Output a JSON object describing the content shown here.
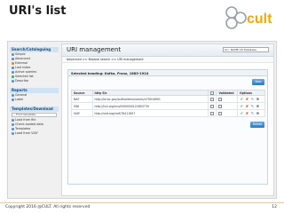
{
  "slide": {
    "title": "URI's list",
    "copyright": "Copyright 2016 @CULT. All rights reserved",
    "page_number": "12",
    "logo_text": "cult"
  },
  "sidebar": {
    "sections": [
      {
        "header": "Search/Cataloguing",
        "items": [
          {
            "label": "Simple",
            "icon": "dot-icon"
          },
          {
            "label": "Advanced",
            "icon": "dot-icon"
          },
          {
            "label": "External",
            "icon": "dot-icon"
          },
          {
            "label": "Last index",
            "icon": "dot-icon"
          },
          {
            "label": "Active queries",
            "icon": "dot-icon"
          },
          {
            "label": "Selected list",
            "icon": "dot-icon"
          },
          {
            "label": "Describe",
            "icon": "dot-icon"
          }
        ]
      },
      {
        "header": "Reports",
        "items": [
          {
            "label": "General",
            "icon": "dot-icon"
          },
          {
            "label": "Label",
            "icon": "dot-icon"
          }
        ]
      },
      {
        "header": "Templates/Download",
        "select": "-- From template",
        "items": [
          {
            "label": "Load from file",
            "icon": "dot-icon"
          },
          {
            "label": "Check-loaded data",
            "icon": "dot-icon"
          },
          {
            "label": "Templates",
            "icon": "dot-icon"
          },
          {
            "label": "Load from VIAF",
            "icon": "dot-icon"
          }
        ]
      }
    ]
  },
  "main": {
    "title": "URI management",
    "db_select": "Arc. NAME:US Database",
    "breadcrumb": "Advanced >> Browse search >> URI management",
    "panel": {
      "heading": "Selected heading: Kafka, Franz, 1883-1924",
      "new_button": "New",
      "delete_button": "Delete",
      "columns": [
        "Source",
        "http Sic",
        "",
        "Validated",
        "Options"
      ],
      "rows": [
        {
          "source": "NAF",
          "link": "http://id.loc.gov/authorities/names/n79018991"
        },
        {
          "source": "ISNI",
          "link": "http://isni.org/isni/0000000122803730"
        },
        {
          "source": "VIAF",
          "link": "http://viaf.org/viaf/76411657"
        }
      ]
    }
  },
  "colors": {
    "accent": "#2f78bf",
    "sidebar_header": "#cfe3f5",
    "logo_ring": "#9aa0a6",
    "logo_text": "#f2a900"
  }
}
